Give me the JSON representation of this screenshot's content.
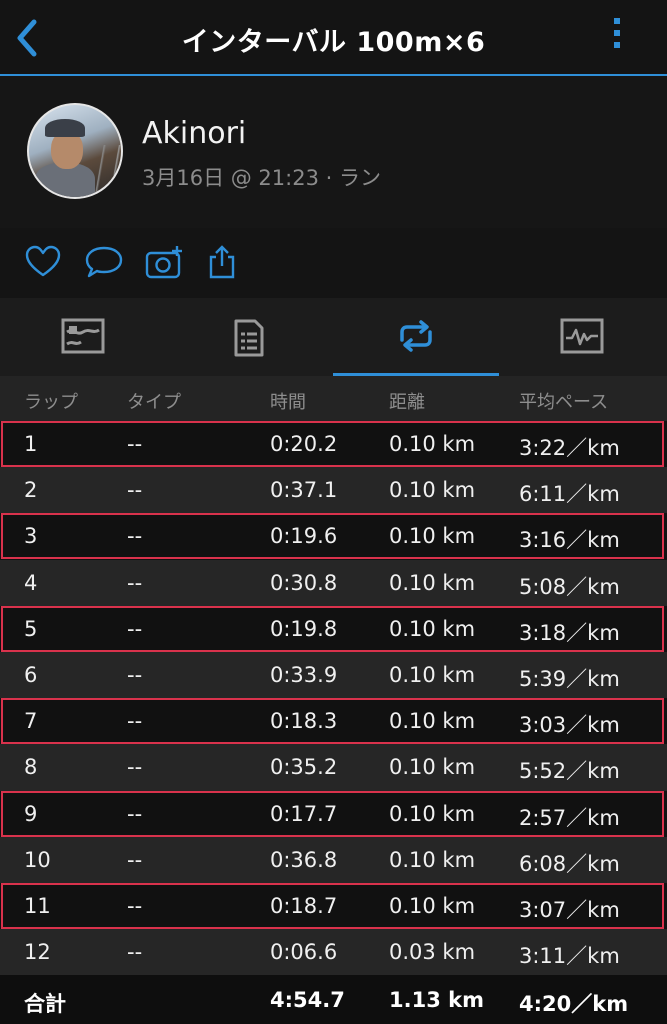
{
  "header": {
    "title": "インターバル 100m×6"
  },
  "profile": {
    "name": "Akinori",
    "meta": "3月16日 @ 21:23 · ラン"
  },
  "actions": [
    "heart-icon",
    "comment-icon",
    "camera-add-icon",
    "share-icon"
  ],
  "tabs": [
    "summary-map-icon",
    "details-list-icon",
    "laps-loop-icon",
    "chart-icon"
  ],
  "colors": {
    "accent": "#2f8fd8",
    "highlight": "#d9324c",
    "background": "#141414"
  },
  "table": {
    "columns": [
      "ラップ",
      "タイプ",
      "時間",
      "距離",
      "平均ペース"
    ],
    "rows": [
      {
        "lap": "1",
        "type": "--",
        "time": "0:20.2",
        "dist": "0.10 km",
        "pace": "3:22／km"
      },
      {
        "lap": "2",
        "type": "--",
        "time": "0:37.1",
        "dist": "0.10 km",
        "pace": "6:11／km"
      },
      {
        "lap": "3",
        "type": "--",
        "time": "0:19.6",
        "dist": "0.10 km",
        "pace": "3:16／km"
      },
      {
        "lap": "4",
        "type": "--",
        "time": "0:30.8",
        "dist": "0.10 km",
        "pace": "5:08／km"
      },
      {
        "lap": "5",
        "type": "--",
        "time": "0:19.8",
        "dist": "0.10 km",
        "pace": "3:18／km"
      },
      {
        "lap": "6",
        "type": "--",
        "time": "0:33.9",
        "dist": "0.10 km",
        "pace": "5:39／km"
      },
      {
        "lap": "7",
        "type": "--",
        "time": "0:18.3",
        "dist": "0.10 km",
        "pace": "3:03／km"
      },
      {
        "lap": "8",
        "type": "--",
        "time": "0:35.2",
        "dist": "0.10 km",
        "pace": "5:52／km"
      },
      {
        "lap": "9",
        "type": "--",
        "time": "0:17.7",
        "dist": "0.10 km",
        "pace": "2:57／km"
      },
      {
        "lap": "10",
        "type": "--",
        "time": "0:36.8",
        "dist": "0.10 km",
        "pace": "6:08／km"
      },
      {
        "lap": "11",
        "type": "--",
        "time": "0:18.7",
        "dist": "0.10 km",
        "pace": "3:07／km"
      },
      {
        "lap": "12",
        "type": "--",
        "time": "0:06.6",
        "dist": "0.03 km",
        "pace": "3:11／km"
      }
    ],
    "total": {
      "label": "合計",
      "time": "4:54.7",
      "dist": "1.13 km",
      "pace": "4:20／km"
    }
  }
}
